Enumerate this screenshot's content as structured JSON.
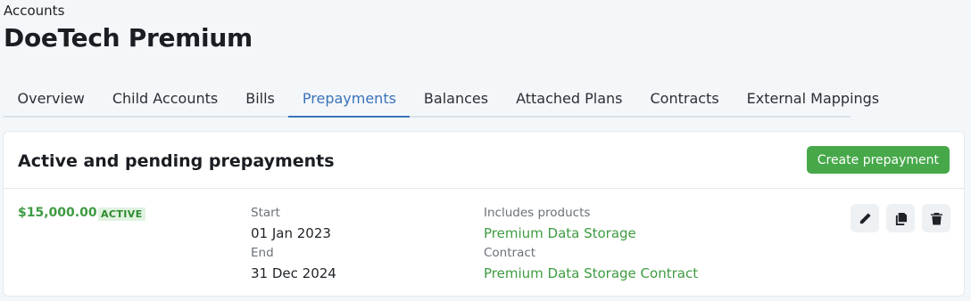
{
  "breadcrumb": "Accounts",
  "title": "DoeTech Premium",
  "tabs": [
    {
      "label": "Overview"
    },
    {
      "label": "Child Accounts"
    },
    {
      "label": "Bills"
    },
    {
      "label": "Prepayments",
      "active": true
    },
    {
      "label": "Balances"
    },
    {
      "label": "Attached Plans"
    },
    {
      "label": "Contracts"
    },
    {
      "label": "External Mappings"
    }
  ],
  "card": {
    "title": "Active and pending prepayments",
    "create_label": "Create prepayment"
  },
  "prepayment": {
    "amount": "$15,000.00",
    "status": "ACTIVE",
    "start_label": "Start",
    "start": "01 Jan 2023",
    "end_label": "End",
    "end": "31 Dec 2024",
    "products_label": "Includes products",
    "product": "Premium Data Storage",
    "contract_label": "Contract",
    "contract": "Premium Data Storage Contract"
  },
  "icons": {
    "edit": "pencil-icon",
    "copy": "copy-icon",
    "delete": "trash-icon"
  },
  "colors": {
    "accent_green": "#47a84a",
    "tab_active": "#3a73b8"
  }
}
